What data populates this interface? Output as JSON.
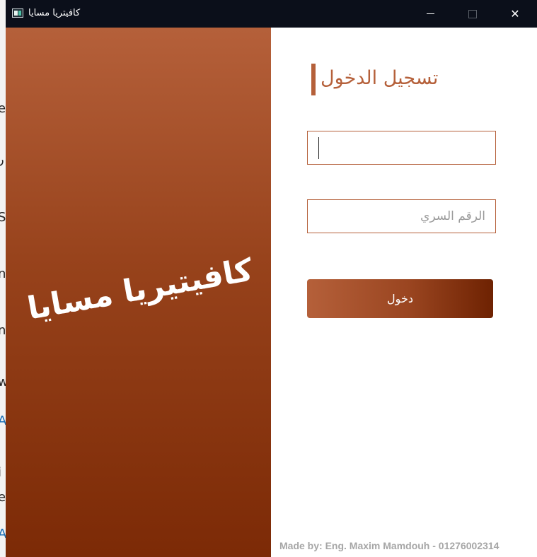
{
  "window": {
    "title": "كافيتريا مسايا",
    "app_icon": "app-window-icon",
    "controls": {
      "minimize": "minimize-icon",
      "maximize": "maximize-icon",
      "close": "close-icon",
      "close_glyph": "✕"
    }
  },
  "background_window": {
    "partial_chars": [
      "e",
      "ر",
      "S",
      "n",
      "n",
      "w",
      "A",
      "i",
      "e",
      "A"
    ]
  },
  "branding": {
    "cafe_name": "كافيتيريا مسايا"
  },
  "login": {
    "heading": "تسجيل الدخول",
    "username": {
      "value": "",
      "placeholder": ""
    },
    "password": {
      "value": "",
      "placeholder": "الرقم السري"
    },
    "submit_label": "دخول"
  },
  "footer": {
    "credit": "Made by: Eng. Maxim Mamdouh - 01276002314"
  },
  "colors": {
    "accent": "#b5603a",
    "gradient_top": "#b5603a",
    "gradient_bottom": "#7c2a06",
    "titlebar": "#0b0f1a",
    "footer_text": "#a6a6a6"
  }
}
